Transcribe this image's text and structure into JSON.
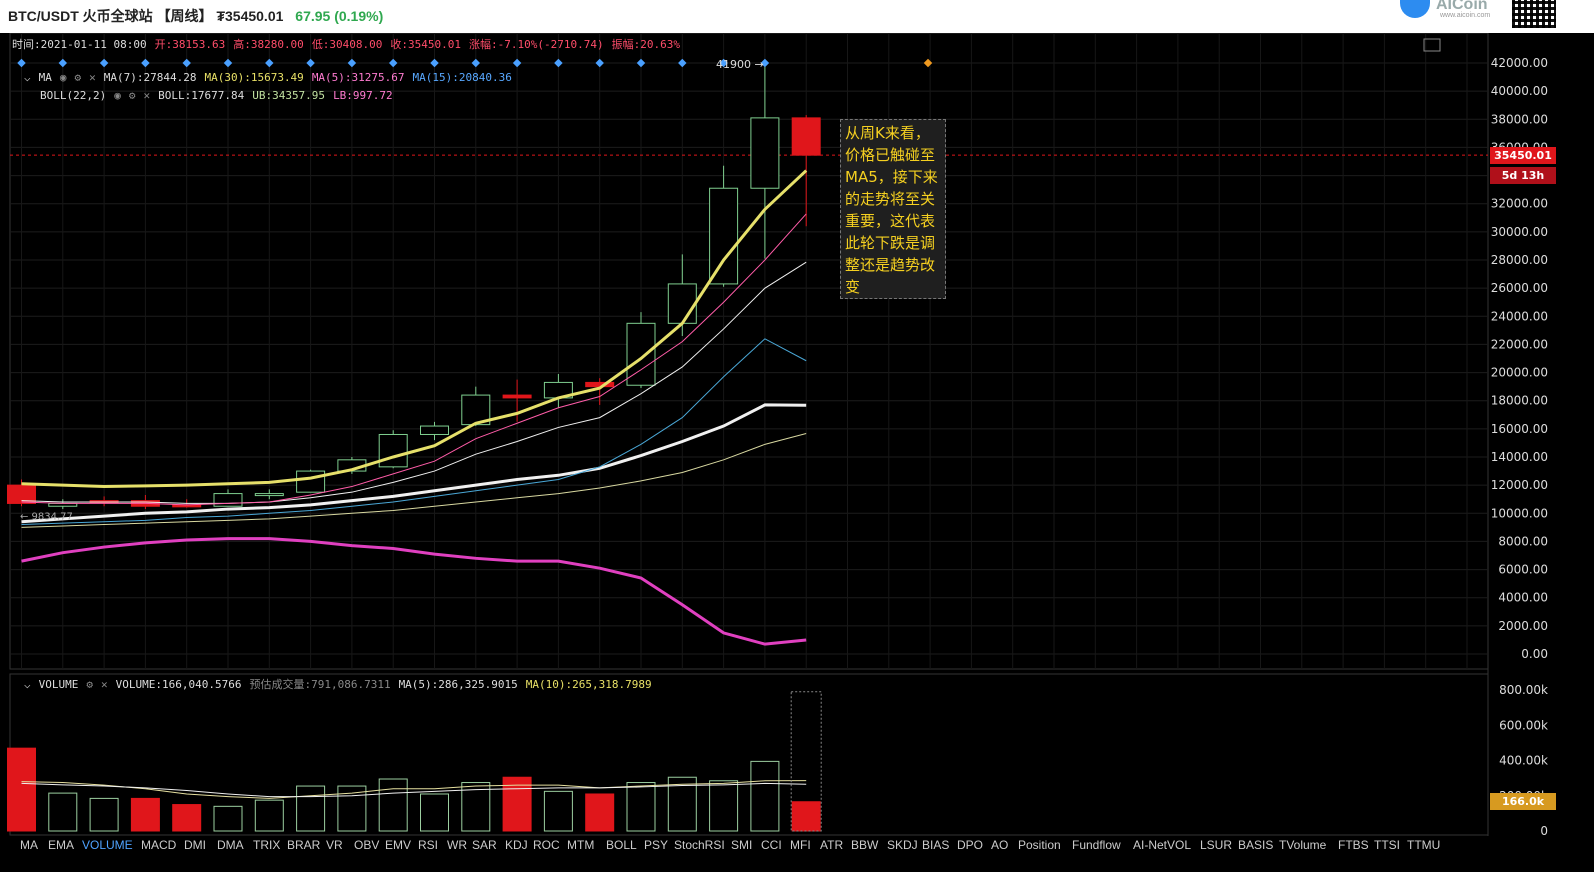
{
  "header": {
    "pair": "BTC/USDT",
    "exchange": "火币全球站",
    "period": "【周线】",
    "price": "₮35450.01",
    "change": "67.95 (0.19%)"
  },
  "logo": {
    "name": "AICoin",
    "url": "www.aicoin.com"
  },
  "ohlc": {
    "time": "时间:2021-01-11 08:00",
    "open": "开:38153.63",
    "high": "高:38280.00",
    "low": "低:30408.00",
    "close": "收:35450.01",
    "change": "涨幅:-7.10%(-2710.74)",
    "amplitude": "振幅:20.63%"
  },
  "ma_legend": {
    "label": "MA",
    "ma7": "MA(7):27844.28",
    "ma30": "MA(30):15673.49",
    "ma5": "MA(5):31275.67",
    "ma15": "MA(15):20840.36"
  },
  "boll_legend": {
    "label": "BOLL(22,2)",
    "boll": "BOLL:17677.84",
    "ub": "UB:34357.95",
    "lb": "LB:997.72"
  },
  "volume_legend": {
    "label": "VOLUME",
    "volume": "VOLUME:166,040.5766",
    "estimate": "预估成交量:791,086.7311",
    "ma5": "MA(5):286,325.9015",
    "ma10": "MA(10):265,318.7989"
  },
  "annotation": "从周K来看，价格已触碰至MA5，接下来的走势将至关重要，这代表此轮下跌是调整还是趋势改变",
  "price_tag": {
    "price": "35450.01",
    "countdown": "5d 13h",
    "volume": "166.0k"
  },
  "high_marker": "41900",
  "left_marker": "9834.77",
  "indicators": [
    "MA",
    "EMA",
    "VOLUME",
    "MACD",
    "DMI",
    "DMA",
    "TRIX",
    "BRAR",
    "VR",
    "OBV",
    "EMV",
    "RSI",
    "WR",
    "SAR",
    "KDJ",
    "ROC",
    "MTM",
    "BOLL",
    "PSY",
    "StochRSI",
    "SMI",
    "CCI",
    "MFI",
    "ATR",
    "BBW",
    "SKDJ",
    "BIAS",
    "DPO",
    "AO",
    "Position",
    "Fundflow",
    "AI-NetVOL",
    "LSUR",
    "BASIS",
    "TVolume",
    "FTBS",
    "TTSI",
    "TTMU"
  ],
  "active_indicator": "VOLUME",
  "colors": {
    "up": "#7fcf8f",
    "down": "#e0161b",
    "ma5": "#ff5ca8",
    "ma7": "#e6e06a",
    "ma15": "#4aa7d6",
    "ma30": "#f0f0f0",
    "boll_ub": "#e6e06a",
    "boll_lb": "#e040c0"
  },
  "chart_data": {
    "type": "candlestick",
    "price_axis": {
      "ticks": [
        0,
        2000,
        4000,
        6000,
        8000,
        10000,
        12000,
        14000,
        16000,
        18000,
        20000,
        22000,
        24000,
        26000,
        28000,
        30000,
        32000,
        34000,
        36000,
        38000,
        40000,
        42000
      ],
      "labels": [
        "0.00",
        "2000.00",
        "4000.00",
        "6000.00",
        "8000.00",
        "10000.00",
        "12000.00",
        "14000.00",
        "16000.00",
        "18000.00",
        "20000.00",
        "22000.00",
        "24000.00",
        "26000.00",
        "28000.00",
        "30000.00",
        "32000.00",
        "34000.00",
        "36000.00",
        "38000.00",
        "40000.00",
        "42000.00"
      ]
    },
    "volume_axis": {
      "ticks": [
        0,
        200000,
        400000,
        600000,
        800000
      ],
      "labels": [
        "0",
        "200.00k",
        "400.00k",
        "600.00k",
        "800.00k"
      ]
    },
    "candles": [
      {
        "o": 12000,
        "h": 12400,
        "l": 10500,
        "c": 10700
      },
      {
        "o": 10500,
        "h": 11000,
        "l": 10300,
        "c": 10700
      },
      {
        "o": 10900,
        "h": 11200,
        "l": 10500,
        "c": 10800
      },
      {
        "o": 10900,
        "h": 11300,
        "l": 10300,
        "c": 10500
      },
      {
        "o": 10600,
        "h": 11000,
        "l": 10400,
        "c": 10500
      },
      {
        "o": 10500,
        "h": 11700,
        "l": 10500,
        "c": 11400
      },
      {
        "o": 11400,
        "h": 11700,
        "l": 11000,
        "c": 11400
      },
      {
        "o": 11500,
        "h": 13100,
        "l": 11500,
        "c": 13000
      },
      {
        "o": 13000,
        "h": 14000,
        "l": 12800,
        "c": 13800
      },
      {
        "o": 13300,
        "h": 15900,
        "l": 13200,
        "c": 15600
      },
      {
        "o": 15600,
        "h": 16500,
        "l": 15200,
        "c": 16200
      },
      {
        "o": 16300,
        "h": 19000,
        "l": 16200,
        "c": 18400
      },
      {
        "o": 18400,
        "h": 19500,
        "l": 16500,
        "c": 18200
      },
      {
        "o": 18200,
        "h": 19900,
        "l": 17500,
        "c": 19300
      },
      {
        "o": 19300,
        "h": 19600,
        "l": 17700,
        "c": 19000
      },
      {
        "o": 19100,
        "h": 24300,
        "l": 18900,
        "c": 23500
      },
      {
        "o": 23500,
        "h": 28400,
        "l": 22600,
        "c": 26300
      },
      {
        "o": 26300,
        "h": 34700,
        "l": 26100,
        "c": 33100
      },
      {
        "o": 33100,
        "h": 41900,
        "l": 28100,
        "c": 38100
      },
      {
        "o": 38100,
        "h": 38300,
        "l": 30400,
        "c": 35450
      }
    ],
    "ma7": [
      null,
      null,
      null,
      null,
      null,
      null,
      null,
      null,
      null,
      null,
      null,
      null,
      null,
      null,
      null,
      null,
      null,
      null,
      null,
      27844
    ],
    "volumes": [
      {
        "v": 470000,
        "up": false
      },
      {
        "v": 215000,
        "up": true
      },
      {
        "v": 185000,
        "up": true
      },
      {
        "v": 185000,
        "up": false
      },
      {
        "v": 150000,
        "up": false
      },
      {
        "v": 140000,
        "up": true
      },
      {
        "v": 175000,
        "up": true
      },
      {
        "v": 255000,
        "up": true
      },
      {
        "v": 255000,
        "up": true
      },
      {
        "v": 295000,
        "up": true
      },
      {
        "v": 210000,
        "up": true
      },
      {
        "v": 275000,
        "up": true
      },
      {
        "v": 305000,
        "up": false
      },
      {
        "v": 225000,
        "up": true
      },
      {
        "v": 210000,
        "up": false
      },
      {
        "v": 275000,
        "up": true
      },
      {
        "v": 305000,
        "up": true
      },
      {
        "v": 285000,
        "up": true
      },
      {
        "v": 395000,
        "up": true
      },
      {
        "v": 166040,
        "up": false
      }
    ]
  }
}
